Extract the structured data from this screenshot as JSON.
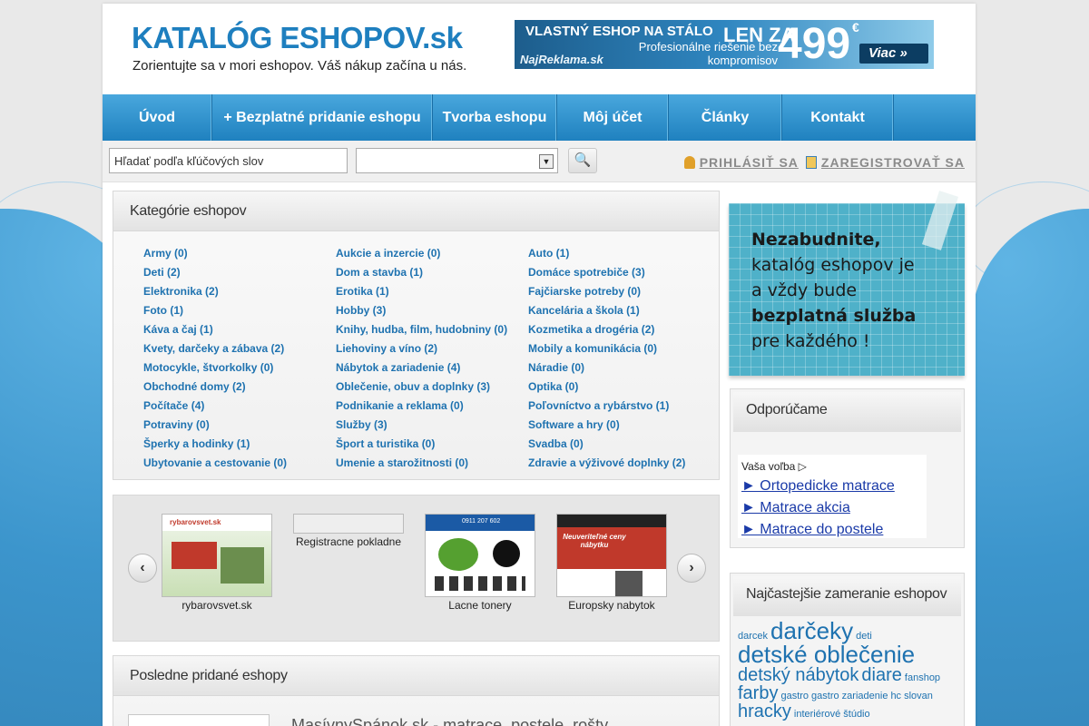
{
  "header": {
    "logo_main": "KATALÓG ESHOPOV",
    "logo_tld": ".sk",
    "tagline": "Zorientujte sa v mori eshopov. Váš nákup začína u nás."
  },
  "ad": {
    "line1": "VLASTNÝ ESHOP NA STÁLO",
    "line2": "Profesionálne riešenie bez kompromisov",
    "brand": "NajReklama.sk",
    "len_za": "LEN ZA",
    "price": "499",
    "currency": "€",
    "more": "Viac"
  },
  "nav": {
    "items": [
      {
        "label": "Úvod"
      },
      {
        "label": "+ Bezplatné pridanie eshopu"
      },
      {
        "label": "Tvorba eshopu"
      },
      {
        "label": "Môj účet"
      },
      {
        "label": "Články"
      },
      {
        "label": "Kontakt"
      }
    ]
  },
  "search": {
    "placeholder": "Hľadať podľa kľúčových slov",
    "select_value": "",
    "login": "PRIHLÁSIŤ SA",
    "register": "ZAREGISTROVAŤ SA"
  },
  "categories": {
    "title": "Kategórie eshopov",
    "col1": [
      "Army (0)",
      "Deti (2)",
      "Elektronika (2)",
      "Foto (1)",
      "Káva a čaj (1)",
      "Kvety, darčeky a zábava (2)",
      "Motocykle, štvorkolky (0)",
      "Obchodné domy (2)",
      "Počítače (4)",
      "Potraviny (0)",
      "Šperky a hodinky (1)",
      "Ubytovanie a cestovanie (0)"
    ],
    "col2": [
      "Aukcie a inzercie (0)",
      "Dom a stavba (1)",
      "Erotika (1)",
      "Hobby (3)",
      "Knihy, hudba, film, hudobniny (0)",
      "Liehoviny a víno (2)",
      "Nábytok a zariadenie (4)",
      "Oblečenie, obuv a doplnky (3)",
      "Podnikanie a reklama (0)",
      "Služby (3)",
      "Šport a turistika (0)",
      "Umenie a starožitnosti (0)"
    ],
    "col3": [
      "Auto (1)",
      "Domáce spotrebiče (3)",
      "Fajčiarske potreby (0)",
      "Kancelária a škola (1)",
      "Kozmetika a drogéria (2)",
      "Mobily a komunikácia (0)",
      "Náradie (0)",
      "Optika (0)",
      "Poľovníctvo a rybárstvo (1)",
      "Software a hry (0)",
      "Svadba (0)",
      "Zdravie a výživové doplnky (2)"
    ]
  },
  "slider": {
    "items": [
      {
        "caption": "rybarovsvet.sk",
        "thumb_text": "rybarovsvet.sk"
      },
      {
        "caption": "Registracne pokladne",
        "thumb_text": ""
      },
      {
        "caption": "Lacne tonery",
        "thumb_text": "0911 207 602"
      },
      {
        "caption": "Europsky nabytok",
        "thumb_text": "Neuveriteľné ceny nábytku"
      }
    ]
  },
  "recent": {
    "title": "Posledne pridané eshopy",
    "first_title": "MasívnySpánok.sk - matrace, postele, rošty"
  },
  "note": {
    "line1": "Nezabudnite,",
    "line2": "katalóg eshopov je",
    "line3": "a vždy bude",
    "line4": "bezplatná služba",
    "line5": "pre každého !"
  },
  "recommend": {
    "title": "Odporúčame",
    "label": "Vaša voľba",
    "links": [
      "► Ortopedicke matrace",
      "► Matrace akcia",
      "► Matrace do postele"
    ]
  },
  "tags": {
    "title": "Najčastejšie zameranie eshopov",
    "items": [
      {
        "text": "darcek",
        "size": "s"
      },
      {
        "text": "darčeky",
        "size": "xl"
      },
      {
        "text": "deti",
        "size": "s"
      },
      {
        "text": "detské oblečenie",
        "size": "xl"
      },
      {
        "text": "detský nábytok",
        "size": "l"
      },
      {
        "text": "diare",
        "size": "l"
      },
      {
        "text": "fanshop",
        "size": "s"
      },
      {
        "text": "farby",
        "size": "l"
      },
      {
        "text": "gastro",
        "size": "s"
      },
      {
        "text": "gastro zariadenie",
        "size": "s"
      },
      {
        "text": "hc",
        "size": "s"
      },
      {
        "text": "slovan",
        "size": "s"
      },
      {
        "text": "hracky",
        "size": "l"
      },
      {
        "text": "interiérové",
        "size": "s"
      },
      {
        "text": "štúdio",
        "size": "s"
      }
    ]
  }
}
